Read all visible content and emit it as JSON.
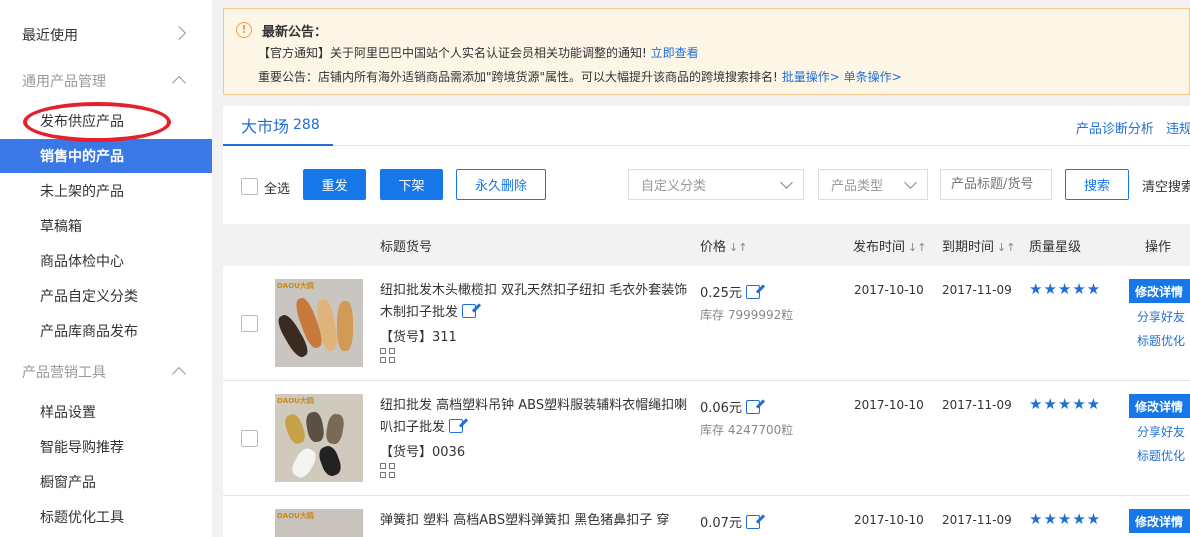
{
  "sidebar": {
    "recent": "最近使用",
    "group1": "通用产品管理",
    "items1": [
      "发布供应产品",
      "销售中的产品",
      "未上架的产品",
      "草稿箱",
      "商品体检中心",
      "产品自定义分类",
      "产品库商品发布"
    ],
    "group2": "产品营销工具",
    "items2": [
      "样品设置",
      "智能导购推荐",
      "橱窗产品",
      "标题优化工具"
    ],
    "active_color": "#3b78e7"
  },
  "notice": {
    "title": "最新公告：",
    "line1_text": "【官方通知】关于阿里巴巴中国站个人实名认证会员相关功能调整的通知!",
    "line1_link": "立即查看",
    "line2_text": "重要公告：店铺内所有海外适销商品需添加\"跨境货源\"属性。可以大幅提升该商品的跨境搜索排名!",
    "line2_link1": "批量操作>",
    "line2_link2": "单条操作>"
  },
  "tabs": {
    "label": "大市场",
    "count": "288",
    "right_link1": "产品诊断分析",
    "right_link2": "违规"
  },
  "toolbar": {
    "select_all": "全选",
    "republish": "重发",
    "unlist": "下架",
    "delete": "永久删除",
    "category_placeholder": "自定义分类",
    "type_placeholder": "产品类型",
    "search_placeholder": "产品标题/货号",
    "search": "搜索",
    "clear": "清空搜索"
  },
  "table": {
    "headers": {
      "title": "标题货号",
      "price": "价格",
      "publish": "发布时间",
      "expire": "到期时间",
      "quality": "质量星级",
      "action": "操作"
    },
    "rows": [
      {
        "title": "纽扣批发木头橄榄扣 双孔天然扣子纽扣 毛衣外套装饰木制扣子批发",
        "sku": "【货号】311",
        "price": "0.25元",
        "stock": "库存 7999992粒",
        "publish": "2017-10-10",
        "expire": "2017-11-09",
        "stars": "★★★★★",
        "edit": "修改详情",
        "share": "分享好友",
        "optimize": "标题优化"
      },
      {
        "title": "纽扣批发 高档塑料吊钟 ABS塑料服装辅料衣帽绳扣喇叭扣子批发",
        "sku": "【货号】0036",
        "price": "0.06元",
        "stock": "库存 4247700粒",
        "publish": "2017-10-10",
        "expire": "2017-11-09",
        "stars": "★★★★★",
        "edit": "修改详情",
        "share": "分享好友",
        "optimize": "标题优化"
      },
      {
        "title": "弹簧扣 塑料 高档ABS塑料弹簧扣 黑色猪鼻扣子 穿",
        "price": "0.07元",
        "publish": "2017-10-10",
        "expire": "2017-11-09",
        "stars": "★★★★★",
        "edit": "修改详情"
      }
    ],
    "brand": "DAOU大鸥"
  }
}
